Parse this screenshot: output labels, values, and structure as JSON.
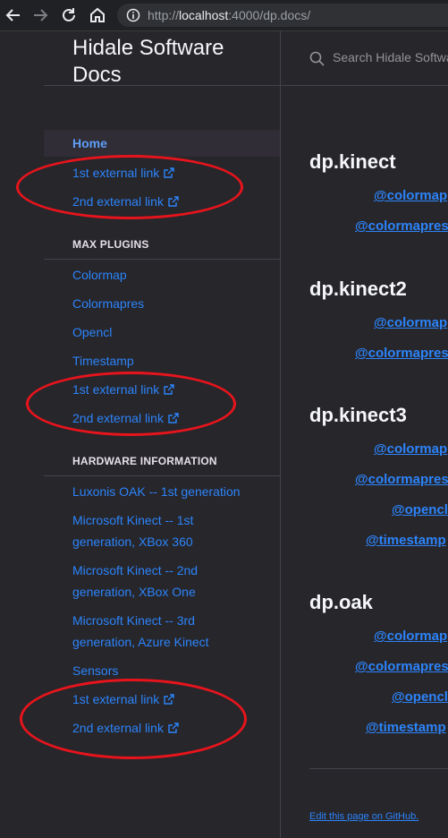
{
  "browser": {
    "url_scheme": "http://",
    "url_host": "localhost",
    "url_rest": ":4000/dp.docs/",
    "icons": [
      "back-arrow-icon",
      "forward-arrow-icon",
      "reload-icon",
      "home-icon",
      "info-icon"
    ]
  },
  "sidebar": {
    "site_title_line1": "Hidale Software",
    "site_title_line2": "Docs",
    "home": "Home",
    "top_links": [
      "1st external link",
      "2nd external link"
    ],
    "max_plugins": {
      "header": "MAX PLUGINS",
      "items": [
        "Colormap",
        "Colormapres",
        "Opencl",
        "Timestamp"
      ],
      "ext_links": [
        "1st external link",
        "2nd external link"
      ]
    },
    "hardware": {
      "header": "HARDWARE INFORMATION",
      "items": [
        {
          "line1": "Luxonis OAK -- 1st generation",
          "line2": ""
        },
        {
          "line1": "Microsoft Kinect -- 1st",
          "line2": "generation, XBox 360"
        },
        {
          "line1": "Microsoft Kinect -- 2nd",
          "line2": "generation, XBox One"
        },
        {
          "line1": "Microsoft Kinect -- 3rd",
          "line2": "generation, Azure Kinect"
        },
        {
          "line1": "Sensors",
          "line2": ""
        }
      ],
      "ext_links": [
        "1st external link",
        "2nd external link"
      ]
    }
  },
  "search": {
    "placeholder": "Search Hidale Software Docs"
  },
  "main": {
    "sections": [
      {
        "title": "dp.kinect",
        "links": [
          "@colormap",
          "@colormapres"
        ]
      },
      {
        "title": "dp.kinect2",
        "links": [
          "@colormap",
          "@colormapres"
        ]
      },
      {
        "title": "dp.kinect3",
        "links": [
          "@colormap",
          "@colormapres",
          "@opencl",
          "@timestamp"
        ]
      },
      {
        "title": "dp.oak",
        "links": [
          "@colormap",
          "@colormapres",
          "@opencl",
          "@timestamp"
        ]
      }
    ],
    "edit_link": "Edit this page on GitHub."
  },
  "colors": {
    "background": "#27262b",
    "link": "#2c84fa",
    "annotation": "#e8141c"
  }
}
